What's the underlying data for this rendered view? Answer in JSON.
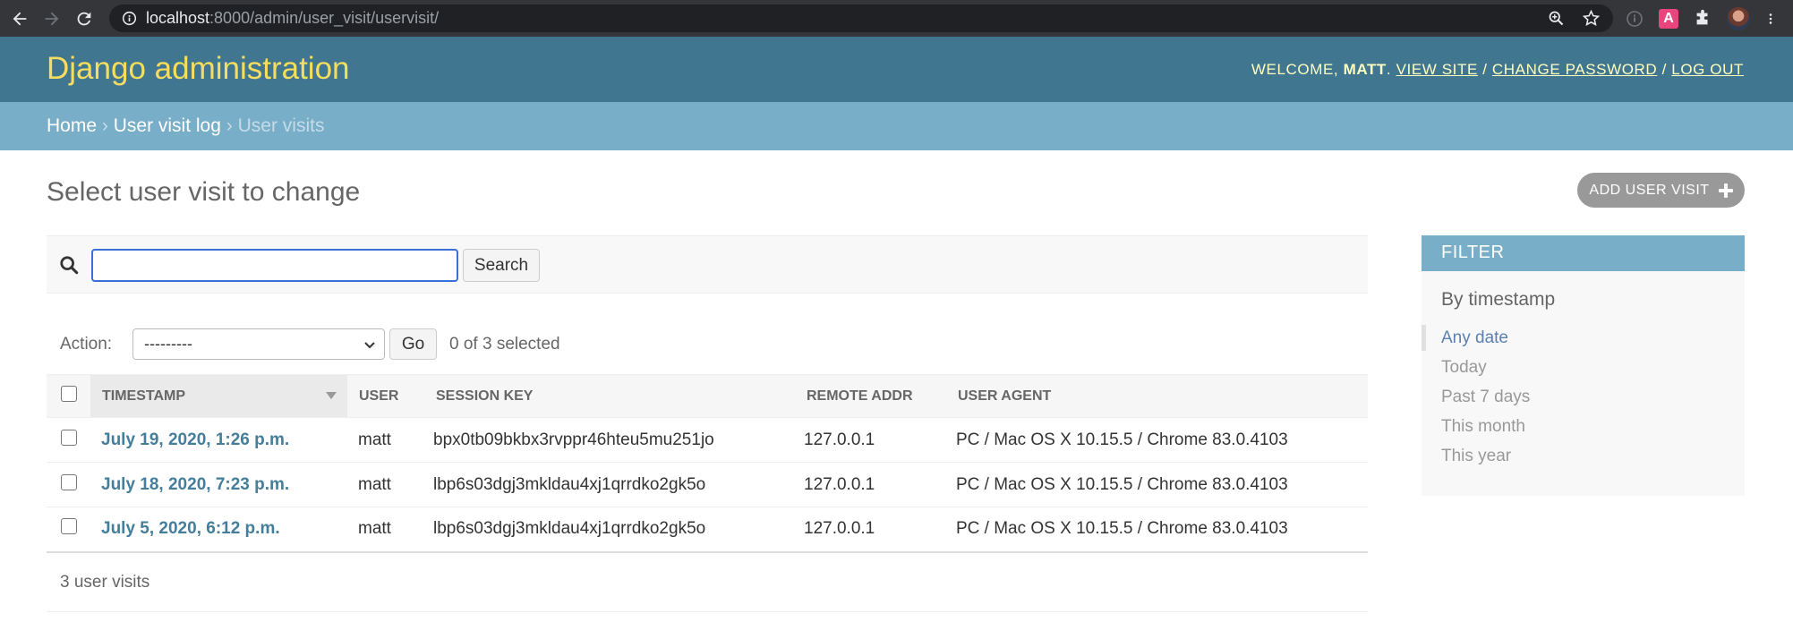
{
  "browser": {
    "url_host": "localhost",
    "url_path": ":8000/admin/user_visit/uservisit/",
    "ext_letter": "A"
  },
  "header": {
    "brand": "Django administration",
    "welcome": "Welcome,",
    "username": "matt",
    "view_site": "View site",
    "change_password": "Change password",
    "log_out": "Log out",
    "separator": "/"
  },
  "breadcrumbs": {
    "home": "Home",
    "app": "User visit log",
    "current": "User visits",
    "sep": "›"
  },
  "page": {
    "title": "Select user visit to change",
    "add_button": "Add user visit"
  },
  "search": {
    "value": "",
    "button": "Search"
  },
  "actions": {
    "label": "Action:",
    "selected_option": "---------",
    "go": "Go",
    "selected_count": "0 of 3 selected"
  },
  "table": {
    "columns": [
      "Timestamp",
      "User",
      "Session key",
      "Remote addr",
      "User agent"
    ],
    "rows": [
      {
        "timestamp": "July 19, 2020, 1:26 p.m.",
        "user": "matt",
        "session_key": "bpx0tb09bkbx3rvppr46hteu5mu251jo",
        "remote_addr": "127.0.0.1",
        "user_agent": "PC / Mac OS X 10.15.5 / Chrome 83.0.4103"
      },
      {
        "timestamp": "July 18, 2020, 7:23 p.m.",
        "user": "matt",
        "session_key": "lbp6s03dgj3mkldau4xj1qrrdko2gk5o",
        "remote_addr": "127.0.0.1",
        "user_agent": "PC / Mac OS X 10.15.5 / Chrome 83.0.4103"
      },
      {
        "timestamp": "July 5, 2020, 6:12 p.m.",
        "user": "matt",
        "session_key": "lbp6s03dgj3mkldau4xj1qrrdko2gk5o",
        "remote_addr": "127.0.0.1",
        "user_agent": "PC / Mac OS X 10.15.5 / Chrome 83.0.4103"
      }
    ],
    "paginator": "3 user visits"
  },
  "filter": {
    "title": "Filter",
    "subtitle": "By timestamp",
    "options": [
      "Any date",
      "Today",
      "Past 7 days",
      "This month",
      "This year"
    ],
    "selected": "Any date"
  },
  "colors": {
    "header_bg": "#417690",
    "breadcrumb_bg": "#79aec8",
    "brand": "#f5dd5d",
    "link": "#447e9b"
  }
}
